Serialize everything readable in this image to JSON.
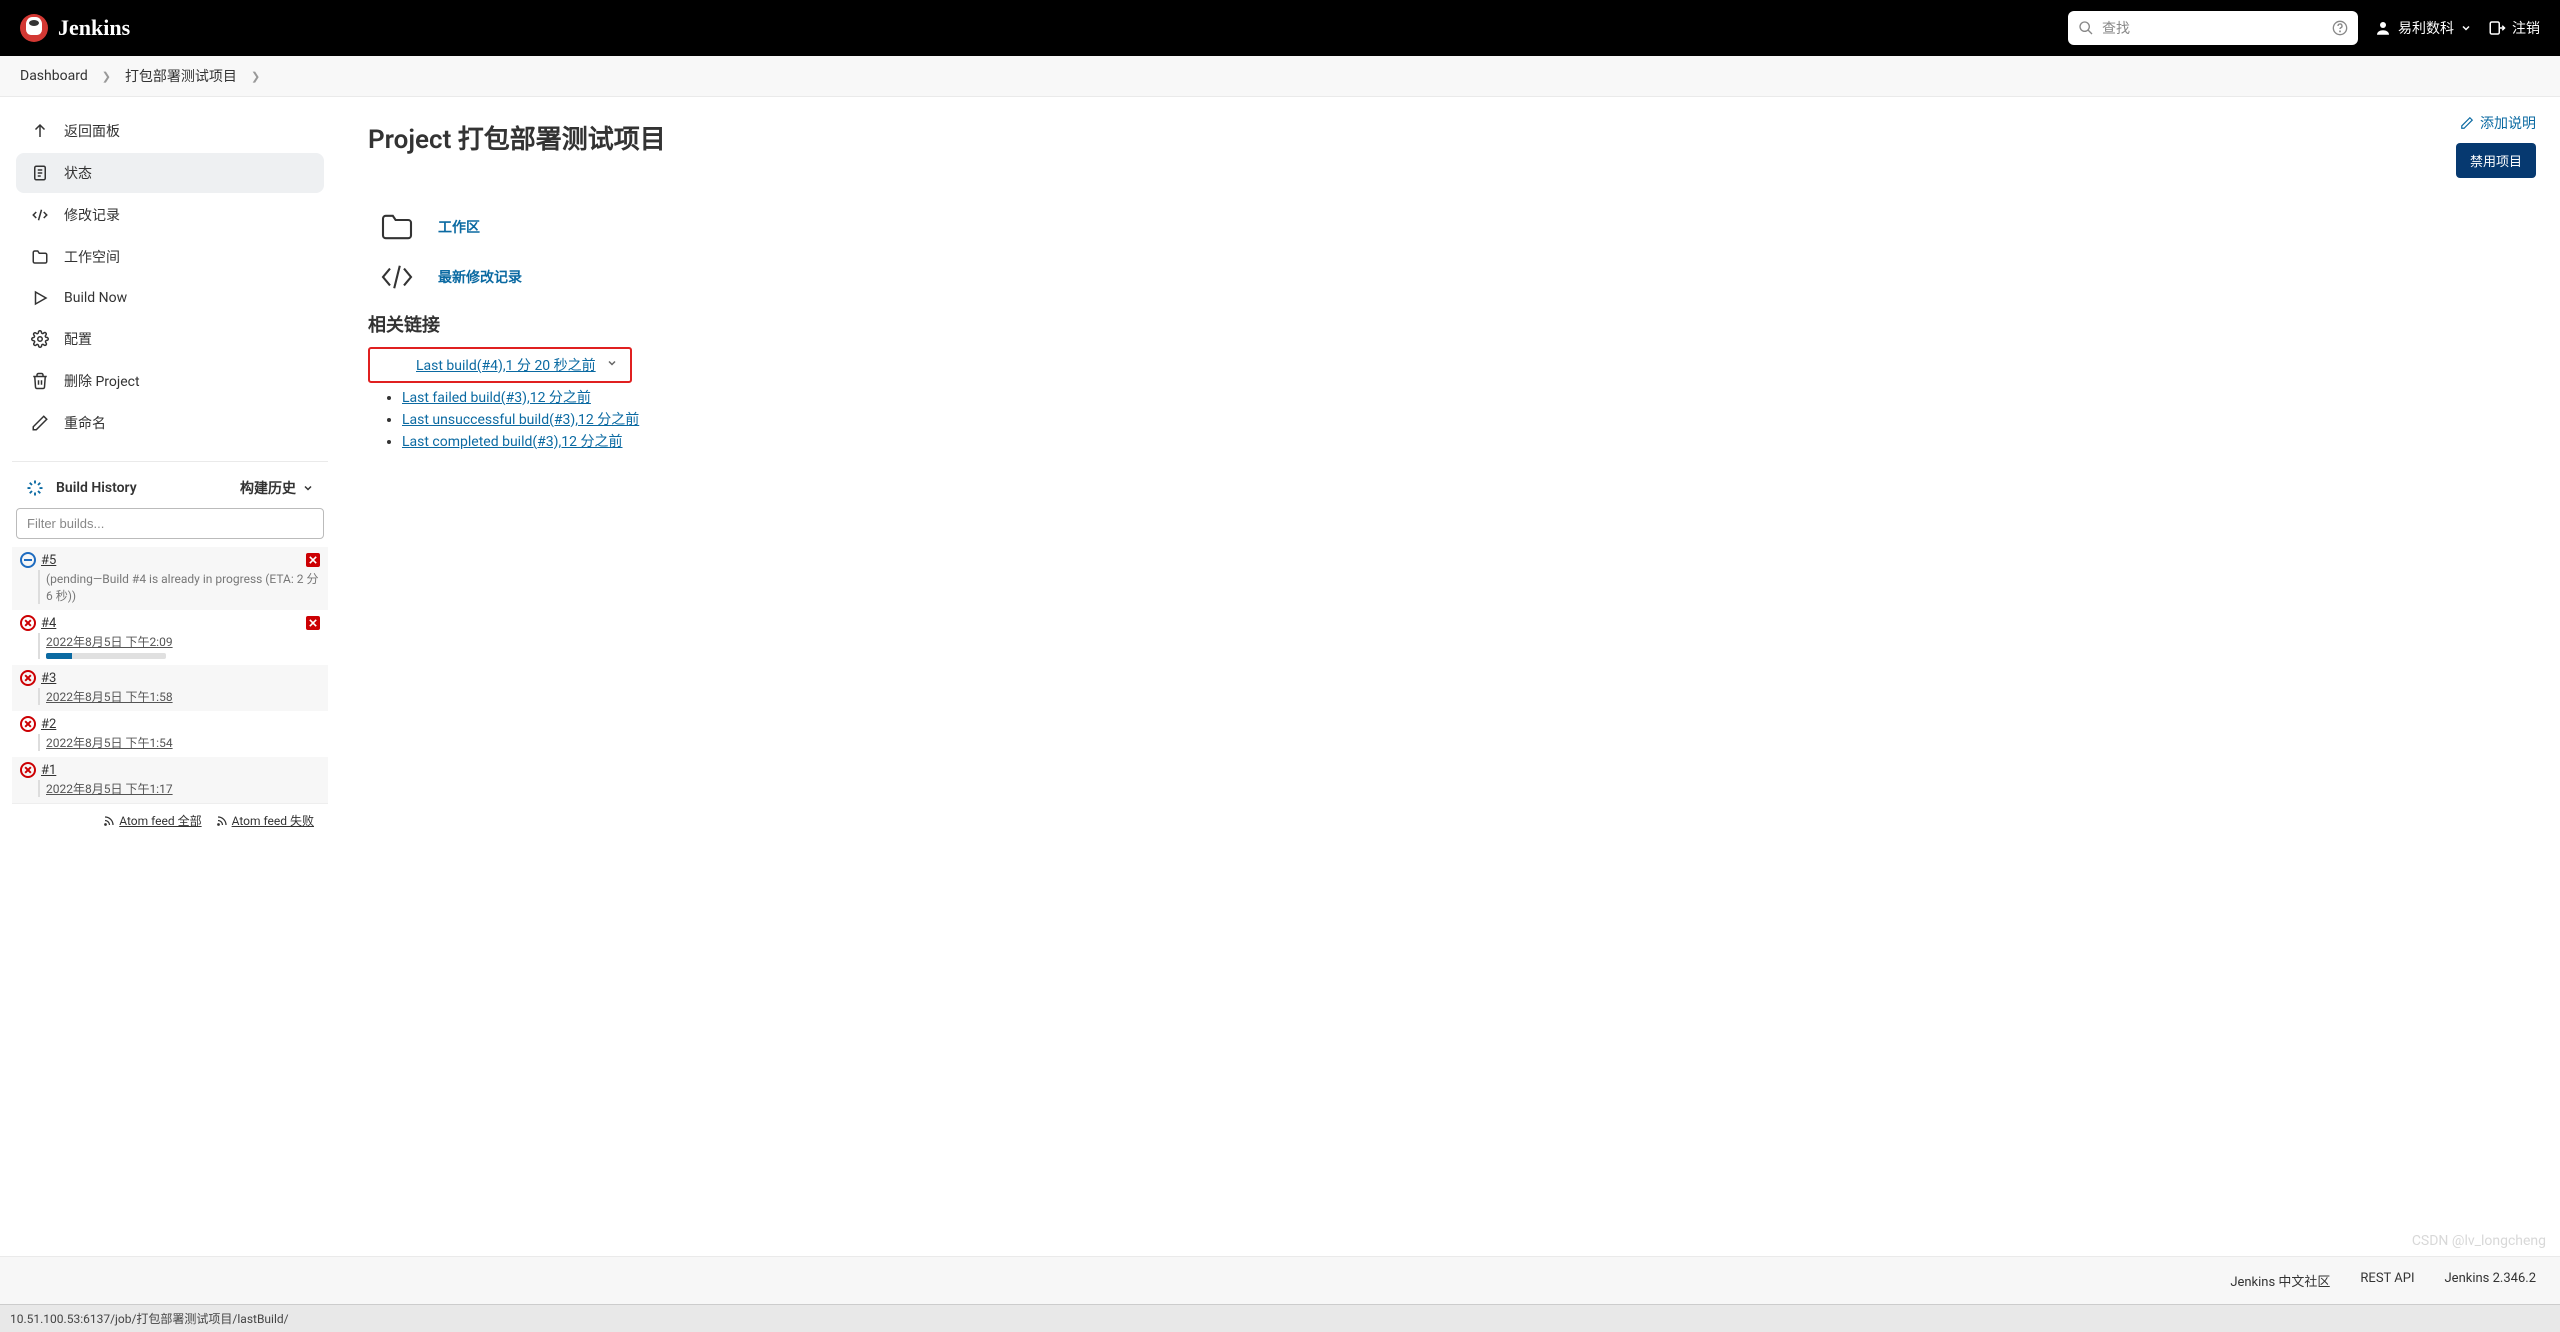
{
  "header": {
    "brand": "Jenkins",
    "search_placeholder": "查找",
    "user_name": "易利数科",
    "logout_label": "注销"
  },
  "breadcrumbs": {
    "items": [
      {
        "label": "Dashboard"
      },
      {
        "label": "打包部署测试项目"
      }
    ]
  },
  "sidebar": {
    "items": [
      {
        "icon": "arrow-up",
        "label": "返回面板"
      },
      {
        "icon": "doc",
        "label": "状态",
        "active": true
      },
      {
        "icon": "code",
        "label": "修改记录"
      },
      {
        "icon": "folder",
        "label": "工作空间"
      },
      {
        "icon": "play",
        "label": "Build Now"
      },
      {
        "icon": "gear",
        "label": "配置"
      },
      {
        "icon": "trash",
        "label": "删除 Project"
      },
      {
        "icon": "pencil",
        "label": "重命名"
      }
    ]
  },
  "history": {
    "title": "Build History",
    "toggle_label": "构建历史",
    "filter_placeholder": "Filter builds...",
    "builds": [
      {
        "num": "#5",
        "status": "pending",
        "cancel": true,
        "pending_text": "(pending—Build #4 is already in progress (ETA: 2 分 6 秒))"
      },
      {
        "num": "#4",
        "status": "fail",
        "cancel": true,
        "time": "2022年8月5日 下午2:09",
        "progress": 22
      },
      {
        "num": "#3",
        "status": "fail",
        "time": "2022年8月5日 下午1:58"
      },
      {
        "num": "#2",
        "status": "fail",
        "time": "2022年8月5日 下午1:54"
      },
      {
        "num": "#1",
        "status": "fail",
        "time": "2022年8月5日 下午1:17"
      }
    ],
    "feed_all": "Atom feed 全部",
    "feed_fail": "Atom feed 失败"
  },
  "content": {
    "title": "Project 打包部署测试项目",
    "add_desc": "添加说明",
    "disable_btn": "禁用项目",
    "workspace_link": "工作区",
    "changes_link": "最新修改记录",
    "related_title": "相关链接",
    "related_links": [
      {
        "text": "Last build(#4),1 分 20 秒之前",
        "highlighted": true,
        "chevron": true
      },
      {
        "text": "Last failed build(#3),12 分之前"
      },
      {
        "text": "Last unsuccessful build(#3),12 分之前"
      },
      {
        "text": "Last completed build(#3),12 分之前"
      }
    ]
  },
  "footer": {
    "community": "Jenkins 中文社区",
    "rest_api": "REST API",
    "version": "Jenkins 2.346.2"
  },
  "status_bar": "10.51.100.53:6137/job/打包部署测试项目/lastBuild/",
  "watermark": "CSDN @lv_longcheng"
}
